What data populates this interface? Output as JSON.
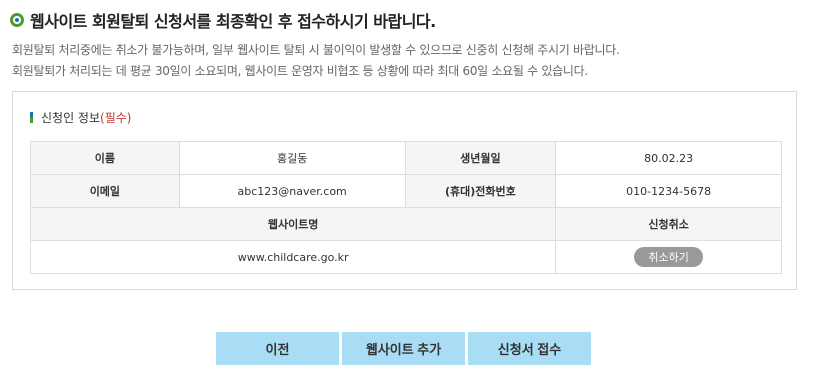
{
  "header": {
    "title": "웹사이트 회원탈퇴 신청서를 최종확인 후 접수하시기 바랍니다."
  },
  "notice": {
    "line1": "회원탈퇴 처리중에는 취소가 불가능하며, 일부 웹사이트 탈퇴 시 불이익이 발생할 수 있으므로 신중히 신청해 주시기 바랍니다.",
    "line2": "회원탈퇴가 처리되는 데 평균 30일이 소요되며, 웹사이트 운영자 비협조 등 상황에 따라 최대 60일 소요될 수 있습니다."
  },
  "applicant": {
    "section_title": "신청인 정보",
    "required_label": "(필수)",
    "name_label": "이름",
    "name_value": "홍길동",
    "birth_label": "생년월일",
    "birth_value": "80.02.23",
    "email_label": "이메일",
    "email_value": "abc123@naver.com",
    "phone_label": "(휴대)전화번호",
    "phone_value": "010-1234-5678",
    "website_header": "웹사이트명",
    "cancel_header": "신청취소",
    "website_value": "www.childcare.go.kr",
    "cancel_button": "취소하기"
  },
  "actions": {
    "prev": "이전",
    "add_website": "웹사이트 추가",
    "submit": "신청서 접수"
  },
  "colors": {
    "button_bg": "#a9dcf5",
    "cancel_bg": "#999999",
    "required": "#c0392b",
    "accent_green": "#4a9e2f",
    "accent_blue": "#1f6fb5"
  }
}
